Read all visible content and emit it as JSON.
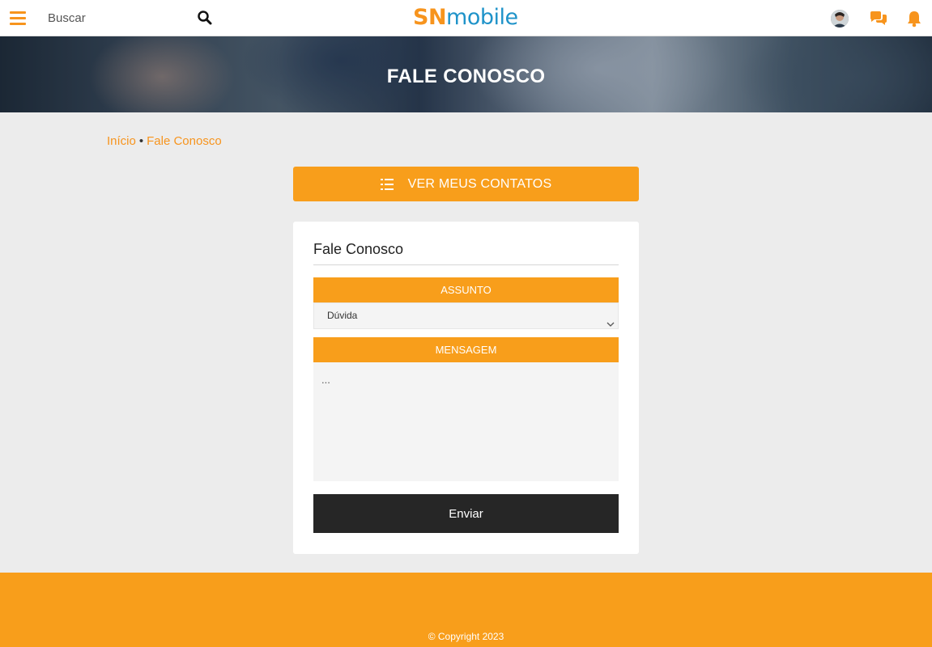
{
  "header": {
    "search_placeholder": "Buscar",
    "logo_part1": "SN",
    "logo_part2": "mobile",
    "brand_color": "#f7941d",
    "logo_secondary_color": "#1f93c9"
  },
  "banner": {
    "title": "FALE CONOSCO"
  },
  "breadcrumb": {
    "home": "Início",
    "separator": "•",
    "current": "Fale Conosco"
  },
  "contacts_button": {
    "label": "VER MEUS CONTATOS",
    "icon": "list-icon"
  },
  "form": {
    "title": "Fale Conosco",
    "subject_label": "ASSUNTO",
    "subject_value": "Dúvida",
    "message_label": "MENSAGEM",
    "message_placeholder": "...",
    "submit_label": "Enviar"
  },
  "footer": {
    "copyright": "© Copyright 2023"
  }
}
